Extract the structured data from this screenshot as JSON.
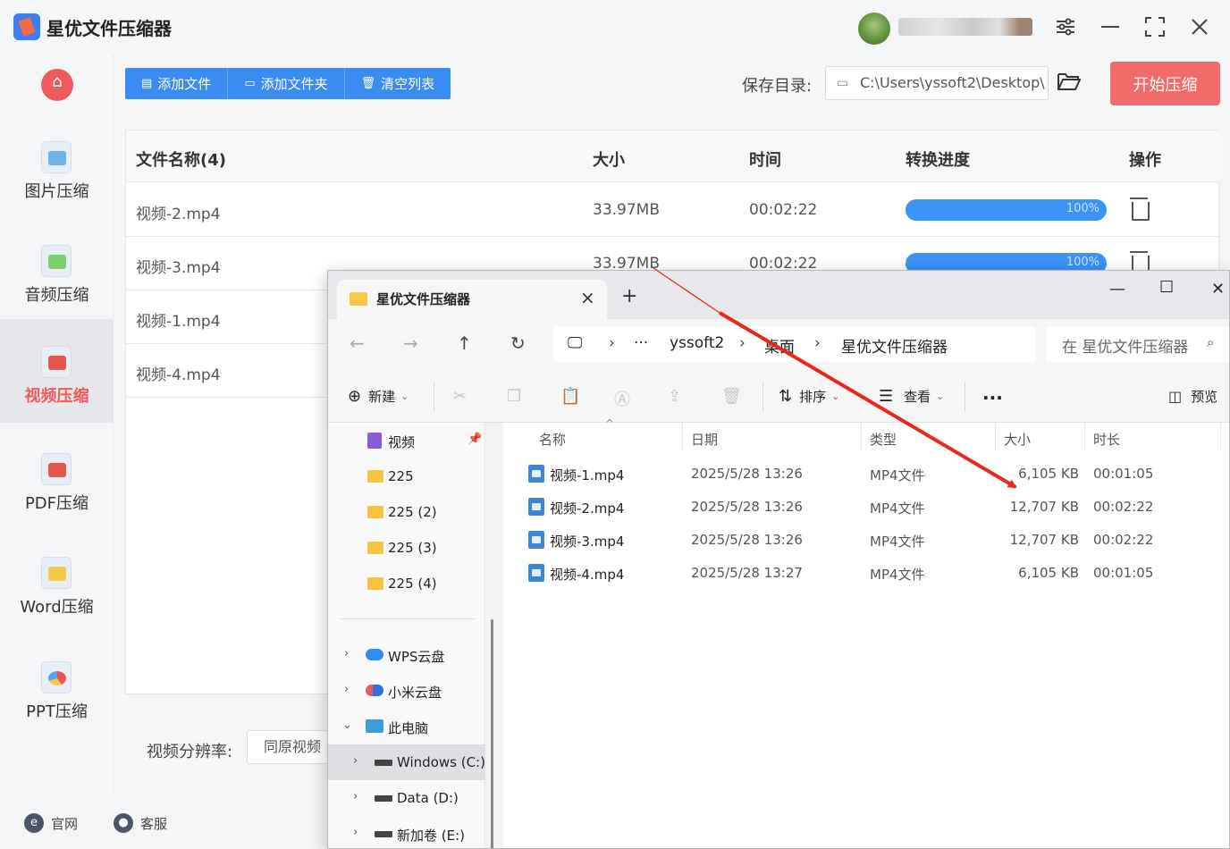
{
  "app": {
    "title": "星优文件压缩器",
    "colors": {
      "accent": "#3b8cf0",
      "brand_red": "#f26b6b",
      "active_nav": "#f05a5a"
    },
    "window_controls": [
      "settings-icon",
      "minimize-icon",
      "maximize-icon",
      "close-icon"
    ]
  },
  "sidebar": {
    "items": [
      {
        "label": "图片压缩",
        "icon": "image-icon",
        "active": false
      },
      {
        "label": "音频压缩",
        "icon": "audio-icon",
        "active": false
      },
      {
        "label": "视频压缩",
        "icon": "video-icon",
        "active": true
      },
      {
        "label": "PDF压缩",
        "icon": "pdf-icon",
        "active": false
      },
      {
        "label": "Word压缩",
        "icon": "word-icon",
        "active": false
      },
      {
        "label": "PPT压缩",
        "icon": "ppt-icon",
        "active": false
      }
    ]
  },
  "toolbar": {
    "add_file": "添加文件",
    "add_folder": "添加文件夹",
    "clear_list": "清空列表",
    "save_dir_label": "保存目录:",
    "save_dir_value": "C:\\Users\\yssoft2\\Desktop\\",
    "start": "开始压缩"
  },
  "table": {
    "headers": {
      "name": "文件名称(4)",
      "size": "大小",
      "time": "时间",
      "progress": "转换进度",
      "action": "操作"
    },
    "rows": [
      {
        "name": "视频-2.mp4",
        "size": "33.97MB",
        "time": "00:02:22",
        "progress": "100%"
      },
      {
        "name": "视频-3.mp4",
        "size": "33.97MB",
        "time": "00:02:22",
        "progress": "100%"
      },
      {
        "name": "视频-1.mp4"
      },
      {
        "name": "视频-4.mp4"
      }
    ]
  },
  "settings": {
    "resolution_label": "视频分辨率:",
    "resolution_value": "同原视频"
  },
  "footer": {
    "website": "官网",
    "service": "客服"
  },
  "explorer": {
    "tab_title": "星优文件压缩器",
    "breadcrumb": [
      "yssoft2",
      "桌面",
      "星优文件压缩器"
    ],
    "search_placeholder": "在 星优文件压缩器",
    "commands": {
      "new": "新建",
      "sort": "排序",
      "view": "查看",
      "preview": "预览"
    },
    "nav": {
      "quick": [
        "视频",
        "225",
        "225 (2)",
        "225 (3)",
        "225 (4)"
      ],
      "drives": [
        "WPS云盘",
        "小米云盘",
        "此电脑",
        "Windows (C:)",
        "Data (D:)",
        "新加卷 (E:)"
      ]
    },
    "columns": {
      "name": "名称",
      "date": "日期",
      "type": "类型",
      "size": "大小",
      "duration": "时长"
    },
    "files": [
      {
        "name": "视频-1.mp4",
        "date": "2025/5/28 13:26",
        "type": "MP4文件",
        "size": "6,105 KB",
        "duration": "00:01:05"
      },
      {
        "name": "视频-2.mp4",
        "date": "2025/5/28 13:26",
        "type": "MP4文件",
        "size": "12,707 KB",
        "duration": "00:02:22"
      },
      {
        "name": "视频-3.mp4",
        "date": "2025/5/28 13:26",
        "type": "MP4文件",
        "size": "12,707 KB",
        "duration": "00:02:22"
      },
      {
        "name": "视频-4.mp4",
        "date": "2025/5/28 13:27",
        "type": "MP4文件",
        "size": "6,105 KB",
        "duration": "00:01:05"
      }
    ]
  }
}
